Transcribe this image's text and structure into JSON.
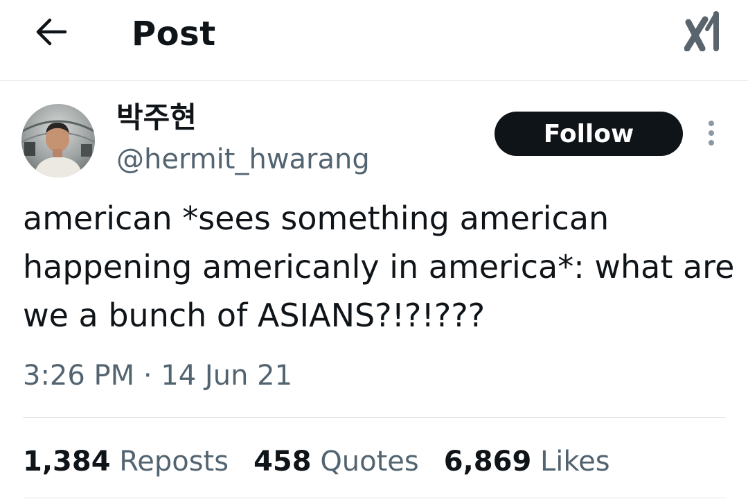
{
  "header": {
    "title": "Post",
    "back_icon": "back-arrow-icon",
    "logo_icon": "x-logo-icon"
  },
  "author": {
    "display_name": "박주현",
    "handle": "@hermit_hwarang",
    "avatar_icon": "avatar-photo"
  },
  "actions": {
    "follow_label": "Follow",
    "more_icon": "more-vertical-icon"
  },
  "post": {
    "text": "american *sees something american happening americanly in america*: what are we a bunch of ASIANS?!?!???",
    "timestamp": "3:26 PM · 14 Jun 21"
  },
  "stats": [
    {
      "count": "1,384",
      "label": "Reposts"
    },
    {
      "count": "458",
      "label": "Quotes"
    },
    {
      "count": "6,869",
      "label": "Likes"
    }
  ],
  "colors": {
    "text_primary": "#0f1419",
    "text_secondary": "#536471",
    "divider": "#e3e6e8",
    "follow_bg": "#0f1419"
  }
}
